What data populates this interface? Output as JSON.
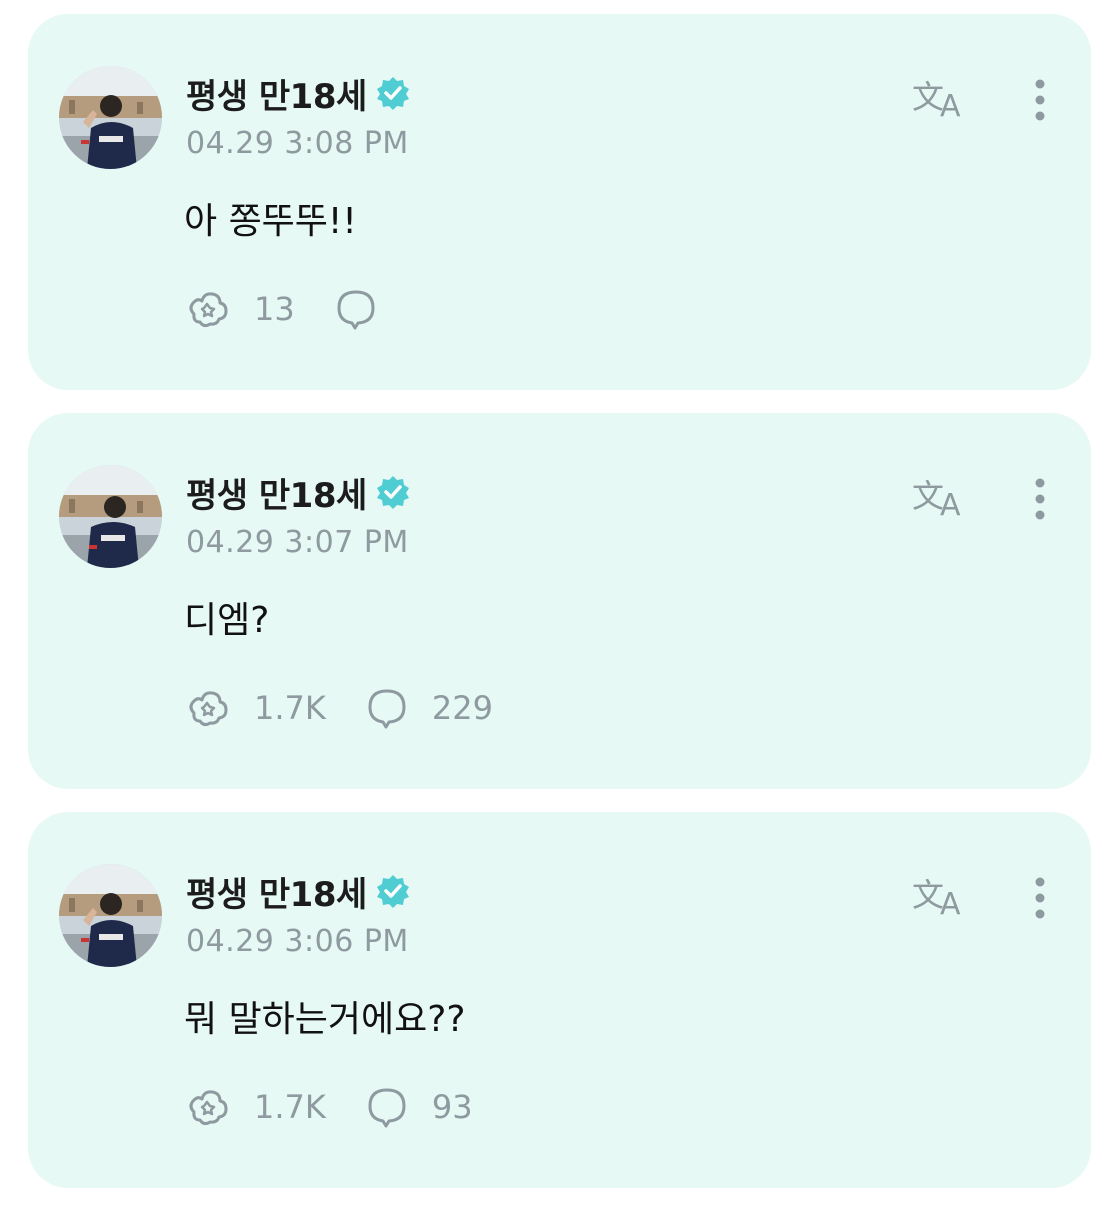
{
  "colors": {
    "card_background": "#e6f9f4",
    "verified_badge": "#4fcdd3",
    "muted_text": "#8e9aa0",
    "body_text": "#111111"
  },
  "icons": {
    "verified": "verified-badge-icon",
    "translate": "translate-icon",
    "more": "more-vertical-icon",
    "like": "fan-like-icon",
    "comment": "comment-bubble-icon"
  },
  "posts": [
    {
      "author": "평생 만18세",
      "timestamp": "04.29 3:08 PM",
      "text": "아 쫑뚜뚜!!",
      "likes": "13",
      "comments": ""
    },
    {
      "author": "평생 만18세",
      "timestamp": "04.29 3:07 PM",
      "text": "디엠?",
      "likes": "1.7K",
      "comments": "229"
    },
    {
      "author": "평생 만18세",
      "timestamp": "04.29 3:06 PM",
      "text": "뭐 말하는거에요??",
      "likes": "1.7K",
      "comments": "93"
    }
  ]
}
